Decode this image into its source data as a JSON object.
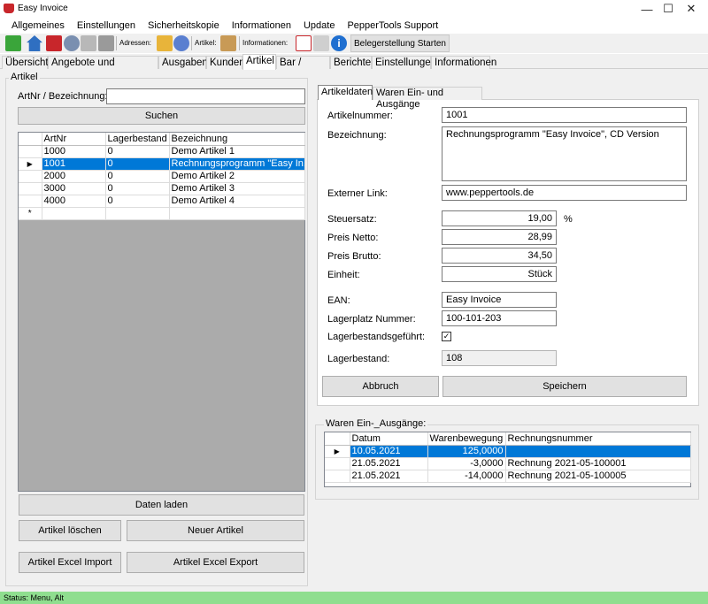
{
  "window": {
    "title": "Easy Invoice",
    "minimize": "—",
    "maximize": "☐",
    "close": "✕"
  },
  "menu": [
    "Allgemeines",
    "Einstellungen",
    "Sicherheitskopie",
    "Informationen",
    "Update",
    "PepperTools Support"
  ],
  "toolbar": {
    "adressen_label": "Adressen:",
    "artikel_label": "Artikel:",
    "informationen_label": "Informationen:",
    "beleg_button": "Belegerstellung Starten"
  },
  "tabs": [
    "Übersicht",
    "Angebote und Einnahmen",
    "Ausgaben",
    "Kunden",
    "Artikel",
    "Bar / Kasse",
    "Berichte",
    "Einstellungen",
    "Informationen"
  ],
  "artikel_panel": {
    "group_label": "Artikel",
    "search_label": "ArtNr / Bezeichnung:",
    "search_value": "",
    "search_button": "Suchen",
    "columns": [
      "ArtNr",
      "Lagerbestand",
      "Bezeichnung"
    ],
    "rows": [
      {
        "artnr": "1000",
        "lager": "0",
        "bez": "Demo Artikel 1"
      },
      {
        "artnr": "1001",
        "lager": "0",
        "bez": "Rechnungsprogramm \"Easy In..."
      },
      {
        "artnr": "2000",
        "lager": "0",
        "bez": "Demo Artikel 2"
      },
      {
        "artnr": "3000",
        "lager": "0",
        "bez": "Demo Artikel 3"
      },
      {
        "artnr": "4000",
        "lager": "0",
        "bez": "Demo Artikel 4"
      }
    ],
    "new_row_marker": "*",
    "daten_laden": "Daten laden",
    "artikel_loeschen": "Artikel löschen",
    "neuer_artikel": "Neuer Artikel",
    "excel_import": "Artikel Excel Import",
    "excel_export": "Artikel Excel Export"
  },
  "detail": {
    "tabs": [
      "Artikeldaten",
      "Waren Ein- und Ausgänge"
    ],
    "artikelnummer_label": "Artikelnummer:",
    "artikelnummer": "1001",
    "bezeichnung_label": "Bezeichnung:",
    "bezeichnung": "Rechnungsprogramm \"Easy Invoice\", CD Version",
    "link_label": "Externer Link:",
    "link": "www.peppertools.de",
    "steuer_label": "Steuersatz:",
    "steuer": "19,00",
    "steuer_unit": "%",
    "netto_label": "Preis Netto:",
    "netto": "28,99",
    "brutto_label": "Preis Brutto:",
    "brutto": "34,50",
    "einheit_label": "Einheit:",
    "einheit": "Stück",
    "ean_label": "EAN:",
    "ean": "Easy Invoice",
    "lagerplatz_label": "Lagerplatz Nummer:",
    "lagerplatz": "100-101-203",
    "lagergefuehrt_label": "Lagerbestandsgeführt:",
    "lagergefuehrt_check": "✓",
    "lagerbestand_label": "Lagerbestand:",
    "lagerbestand": "108",
    "abbruch": "Abbruch",
    "speichern": "Speichern"
  },
  "waren": {
    "group_label": "Waren Ein-_Ausgänge:",
    "columns": [
      "Datum",
      "Warenbewegung",
      "Rechnungsnummer"
    ],
    "rows": [
      {
        "datum": "10.05.2021",
        "menge": "125,0000",
        "rechnung": ""
      },
      {
        "datum": "21.05.2021",
        "menge": "-3,0000",
        "rechnung": "Rechnung 2021-05-100001"
      },
      {
        "datum": "21.05.2021",
        "menge": "-14,0000",
        "rechnung": "Rechnung 2021-05-100005"
      }
    ]
  },
  "status": {
    "text": "Status:  Menu, Alt"
  },
  "colors": {
    "selection": "#0078d7",
    "status_bar": "#8fde8f"
  }
}
